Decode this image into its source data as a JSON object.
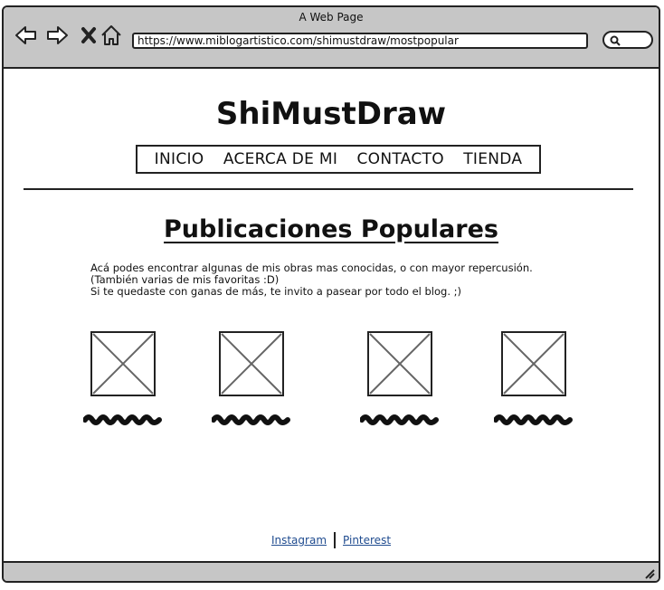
{
  "window": {
    "title": "A Web Page"
  },
  "toolbar": {
    "url": "https://www.miblogartistico.com/shimustdraw/mostpopular",
    "back_icon": "back-arrow-icon",
    "forward_icon": "forward-arrow-icon",
    "stop_icon": "close-icon",
    "home_icon": "home-icon",
    "search_icon": "search-icon"
  },
  "site": {
    "title": "ShiMustDraw"
  },
  "menu": {
    "items": [
      "INICIO",
      "ACERCA DE MI",
      "CONTACTO",
      "TIENDA"
    ]
  },
  "main": {
    "heading": "Publicaciones Populares",
    "intro_line1": "Acá podes encontrar algunas de mis obras mas conocidas, o con mayor repercusión. (También varias de mis favoritas :D)",
    "intro_line2": "Si te quedaste con ganas de más, te invito a pasear por todo el blog. ;)"
  },
  "footer": {
    "links": [
      "Instagram",
      "Pinterest"
    ]
  },
  "colors": {
    "chrome": "#c6c6c6",
    "link": "#1f4b8f",
    "ink": "#222222"
  }
}
